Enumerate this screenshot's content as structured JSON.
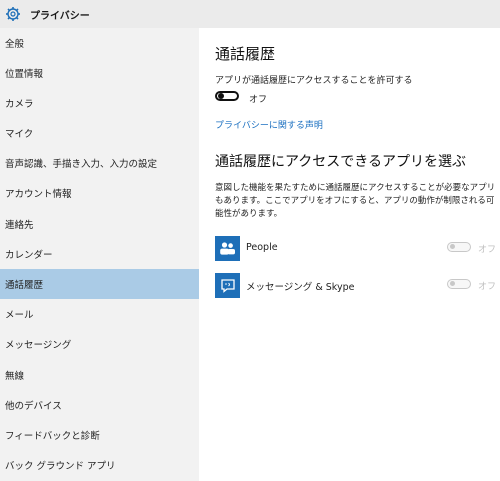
{
  "window": {
    "title": "プライバシー",
    "icon": "gear-icon"
  },
  "sidebar": {
    "items": [
      {
        "label": "全般"
      },
      {
        "label": "位置情報"
      },
      {
        "label": "カメラ"
      },
      {
        "label": "マイク"
      },
      {
        "label": "音声認識、手描き入力、入力の設定"
      },
      {
        "label": "アカウント情報"
      },
      {
        "label": "連絡先"
      },
      {
        "label": "カレンダー"
      },
      {
        "label": "通話履歴",
        "selected": true
      },
      {
        "label": "メール"
      },
      {
        "label": "メッセージング"
      },
      {
        "label": "無線"
      },
      {
        "label": "他のデバイス"
      },
      {
        "label": "フィードバックと診断"
      },
      {
        "label": "バック グラウンド アプリ"
      }
    ]
  },
  "main": {
    "heading": "通話履歴",
    "allow_label": "アプリが通話履歴にアクセスすることを許可する",
    "allow_toggle": {
      "state_label": "オフ",
      "on": false
    },
    "privacy_link": "プライバシーに関する声明",
    "apps_heading": "通話履歴にアクセスできるアプリを選ぶ",
    "apps_description": "意図した機能を果たすために通話履歴にアクセスすることが必要なアプリもあります。ここでアプリをオフにすると、アプリの動作が制限される可能性があります。",
    "apps": [
      {
        "name": "People",
        "icon": "people-icon",
        "state_label": "オフ",
        "on": false,
        "enabled": false
      },
      {
        "name": "メッセージング & Skype",
        "icon": "messaging-icon",
        "state_label": "オフ",
        "on": false,
        "enabled": false
      }
    ]
  },
  "colors": {
    "accent": "#1e6fb8",
    "link": "#1a6fc0",
    "selected_bg": "#aacbe6",
    "sidebar_bg": "#f2f2f2"
  }
}
